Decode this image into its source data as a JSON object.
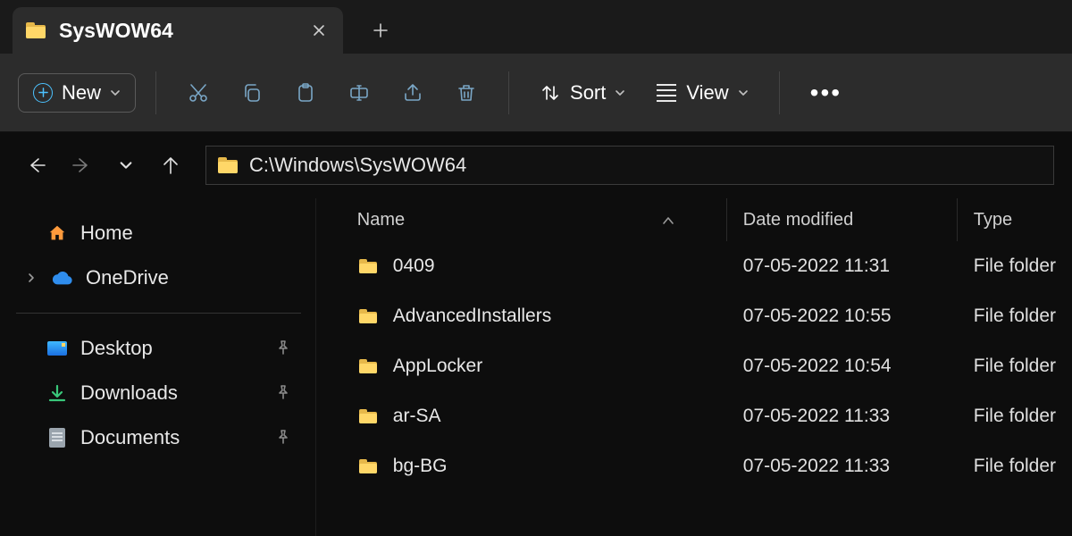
{
  "tab": {
    "title": "SysWOW64"
  },
  "toolbar": {
    "new_label": "New",
    "sort_label": "Sort",
    "view_label": "View"
  },
  "address": {
    "path": "C:\\Windows\\SysWOW64"
  },
  "sidebar": {
    "home": "Home",
    "onedrive": "OneDrive",
    "desktop": "Desktop",
    "downloads": "Downloads",
    "documents": "Documents"
  },
  "columns": {
    "name": "Name",
    "date": "Date modified",
    "type": "Type"
  },
  "files": [
    {
      "name": "0409",
      "date": "07-05-2022 11:31",
      "type": "File folder"
    },
    {
      "name": "AdvancedInstallers",
      "date": "07-05-2022 10:55",
      "type": "File folder"
    },
    {
      "name": "AppLocker",
      "date": "07-05-2022 10:54",
      "type": "File folder"
    },
    {
      "name": "ar-SA",
      "date": "07-05-2022 11:33",
      "type": "File folder"
    },
    {
      "name": "bg-BG",
      "date": "07-05-2022 11:33",
      "type": "File folder"
    }
  ]
}
